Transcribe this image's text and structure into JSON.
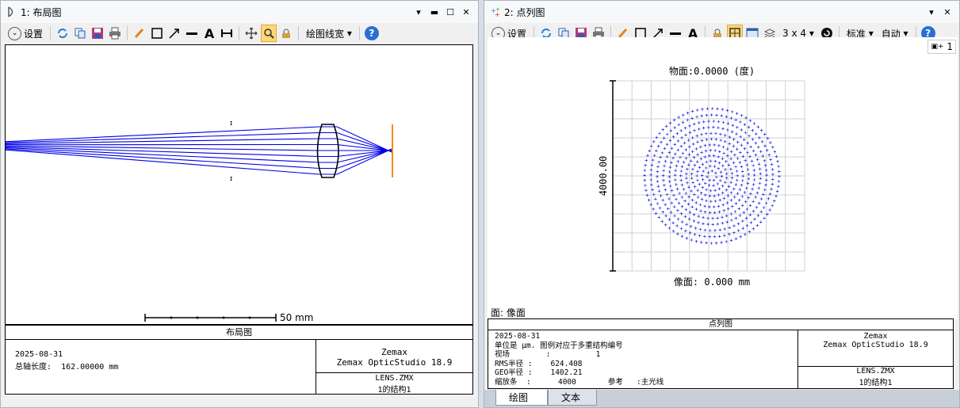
{
  "layout_window": {
    "title": "1: 布局图",
    "toolbar": {
      "settings": "设置",
      "line_width": "绘图线宽"
    },
    "scale_bar_label": "50 mm",
    "footer": {
      "title": "布局图",
      "date": "2025-08-31",
      "total_length_label": "总轴长度:",
      "total_length_value": "162.00000 mm",
      "company": "Zemax",
      "product": "Zemax OpticStudio 18.9",
      "file": "LENS.ZMX",
      "config": "1的结构1"
    }
  },
  "spot_window": {
    "title": "2: 点列图",
    "toolbar": {
      "settings": "设置",
      "grid": "3 x 4",
      "standard": "标准",
      "auto": "自动"
    },
    "legend_badge": "1",
    "field_label": "物面:0.0000 (度)",
    "scale_label": "4000.00",
    "image_label": "像面: 0.000 mm",
    "surface_label": "面: 像面",
    "footer": {
      "title": "点列图",
      "lines": [
        "2025-08-31",
        "单位是 μm. 图例对应于多重结构编号",
        "视场        :          1",
        "RMS半径 :    624.408",
        "GEO半径 :    1402.21",
        "缩放条  :      4000       参考   :主光线"
      ],
      "company": "Zemax",
      "product": "Zemax OpticStudio 18.9",
      "file": "LENS.ZMX",
      "config": "1的结构1"
    },
    "tabs": [
      "绘图",
      "文本"
    ]
  },
  "colors": {
    "ray": "#0000e6",
    "accent": "#ffd779",
    "image_plane": "#f28c1c"
  }
}
